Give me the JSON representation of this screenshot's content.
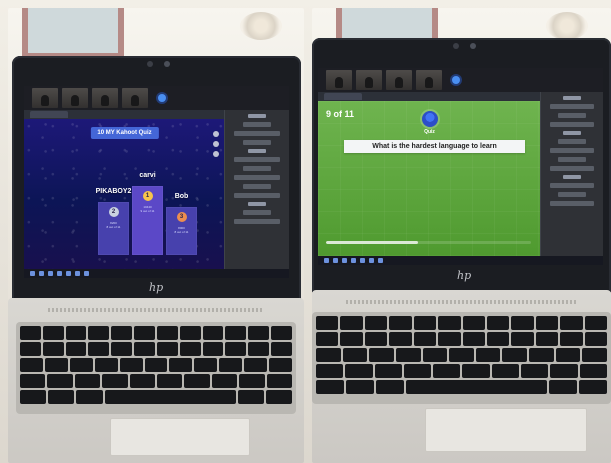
{
  "left_screen": {
    "quiz_title": "10 MY Kahoot Quiz",
    "podium": [
      {
        "place": "2",
        "name": "PIKABOY2",
        "stat_line_1": "8200",
        "stat_line_2": "8 out of 11"
      },
      {
        "place": "1",
        "name": "carvi",
        "stat_line_1": "10440",
        "stat_line_2": "9 out of 11"
      },
      {
        "place": "3",
        "name": "Bob",
        "stat_line_1": "8000",
        "stat_line_2": "8 out of 11"
      }
    ]
  },
  "right_screen": {
    "counter": "9 of 11",
    "brand_label": "Quiz",
    "question": "What is the hardest language to learn",
    "progress": 0.45
  },
  "colors": {
    "kahoot_blue": "#0c1556",
    "kahoot_accent": "#4466d7",
    "quiz_green": "#5ca23b",
    "white": "#ffffff"
  },
  "icons": {
    "meet_badge": "meeting-badge-icon",
    "hp_logo": "hp-logo-icon",
    "camera": "camera-icon"
  }
}
